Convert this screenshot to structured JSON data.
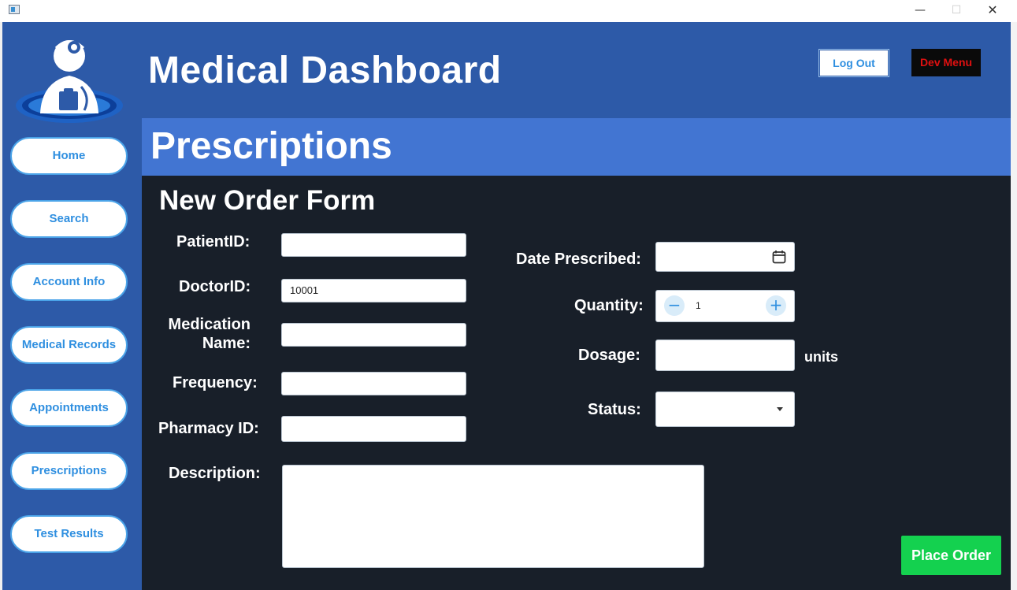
{
  "header": {
    "title": "Medical Dashboard",
    "logout_label": "Log Out",
    "devmenu_label": "Dev Menu"
  },
  "sidebar": {
    "items": [
      {
        "label": "Home"
      },
      {
        "label": "Search"
      },
      {
        "label": "Account Info"
      },
      {
        "label": "Medical Records"
      },
      {
        "label": "Appointments"
      },
      {
        "label": "Prescriptions"
      },
      {
        "label": "Test Results"
      }
    ]
  },
  "page": {
    "title": "Prescriptions"
  },
  "form": {
    "title": "New Order Form",
    "patient_id": {
      "label": "PatientID:",
      "value": ""
    },
    "doctor_id": {
      "label": "DoctorID:",
      "value": "10001"
    },
    "medication_name": {
      "label_line1": "Medication",
      "label_line2": "Name:",
      "value": ""
    },
    "frequency": {
      "label": "Frequency:",
      "value": ""
    },
    "pharmacy_id": {
      "label": "Pharmacy ID:",
      "value": ""
    },
    "description": {
      "label": "Description:",
      "value": ""
    },
    "date_prescribed": {
      "label": "Date Prescribed:",
      "value": ""
    },
    "quantity": {
      "label": "Quantity:",
      "value": "1"
    },
    "dosage": {
      "label": "Dosage:",
      "value": "",
      "units": "units"
    },
    "status": {
      "label": "Status:",
      "value": ""
    },
    "submit_label": "Place Order"
  },
  "colors": {
    "header_bg": "#2d5aa8",
    "section_bar": "#4275d2",
    "content_bg": "#181f29",
    "accent": "#2f8fe0",
    "submit": "#14d14f",
    "devmenu_text": "#e01010"
  }
}
